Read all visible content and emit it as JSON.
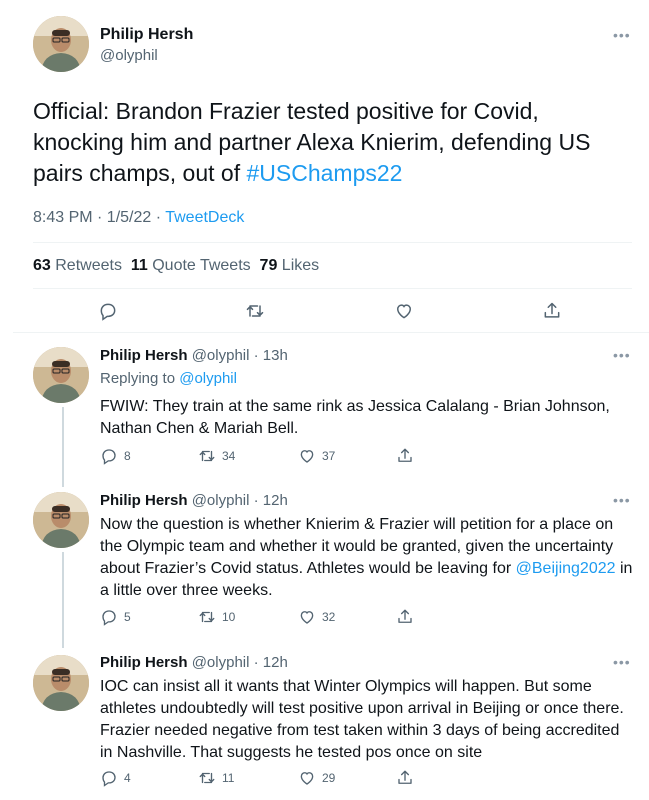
{
  "main_tweet": {
    "author_name": "Philip Hersh",
    "handle": "@olyphil",
    "text_plain": "Official: Brandon Frazier tested positive for Covid, knocking him and partner Alexa Knierim, defending US pairs champs, out of ",
    "hashtag": "#USChamps22",
    "time": "8:43 PM · 1/5/22 · ",
    "source": "TweetDeck",
    "retweets_count": "63",
    "retweets_label": "Retweets",
    "quote_count": "11",
    "quote_label": "Quote Tweets",
    "likes_count": "79",
    "likes_label": "Likes"
  },
  "replies": [
    {
      "author_name": "Philip Hersh",
      "handle_time": "@olyphil · 13h",
      "replying_prefix": "Replying to ",
      "replying_to": "@olyphil",
      "text": "FWIW:  They train at the same rink as Jessica Calalang - Brian Johnson, Nathan Chen & Mariah Bell.",
      "replies": "8",
      "retweets": "34",
      "likes": "37"
    },
    {
      "author_name": "Philip Hersh",
      "handle_time": "@olyphil · 12h",
      "text_before": "Now the question is whether Knierim & Frazier will petition for a place on the Olympic team and whether it would be granted, given the uncertainty about Frazier’s Covid status.  Athletes would be leaving for ",
      "mention": "@Beijing2022",
      "text_after": " in a little over three weeks.",
      "replies": "5",
      "retweets": "10",
      "likes": "32"
    },
    {
      "author_name": "Philip Hersh",
      "handle_time": "@olyphil · 12h",
      "text": "IOC can insist all it wants that Winter Olympics will happen. But some athletes undoubtedly will test positive upon arrival in Beijing or once there.  Frazier needed negative from test taken within 3 days of being accredited in Nashville. That suggests he tested pos once on site",
      "replies": "4",
      "retweets": "11",
      "likes": "29"
    }
  ],
  "icons": [
    "more-icon",
    "reply-icon",
    "retweet-icon",
    "like-icon",
    "share-icon"
  ],
  "colors": {
    "link": "#1d9bf0",
    "muted": "#536471",
    "border": "#eff3f4"
  }
}
